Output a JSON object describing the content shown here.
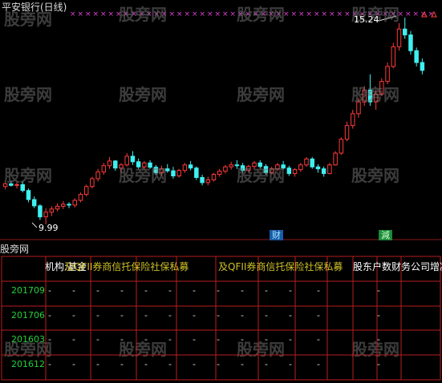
{
  "title": "平安银行(日线)",
  "watermark": "股旁网",
  "labels": {
    "high": "15.24",
    "low": "9.99"
  },
  "markers": {
    "cai": "财",
    "jian": "減"
  },
  "fund": {
    "title": "股旁网",
    "header_a": "机构:基金",
    "header_b": "及QFII券商信托保险社保私募",
    "header_c": "股东户数",
    "header_d": "财务公司",
    "header_e": "增减",
    "rows": [
      {
        "period": "201709",
        "cells": [
          "-",
          "-",
          "-",
          "-",
          "-",
          "-",
          "-",
          "-",
          "-",
          "-",
          "-",
          "-",
          "-"
        ]
      },
      {
        "period": "201706",
        "cells": [
          "-",
          "-",
          "-",
          "-",
          "-",
          "-",
          "-",
          "-",
          "-",
          "-",
          "-",
          "-",
          "-"
        ]
      },
      {
        "period": "201603",
        "cells": [
          "-",
          "-",
          "-",
          "-",
          "-",
          "-",
          "-",
          "-",
          "-",
          "-",
          "-",
          "-",
          "-"
        ]
      },
      {
        "period": "201612",
        "cells": [
          "-",
          "-",
          "-",
          "-",
          "-",
          "-",
          "-",
          "-",
          "-",
          "-",
          "-",
          "-",
          "-"
        ]
      }
    ]
  },
  "candles": [
    [
      10.95,
      11.05,
      10.88,
      11.02
    ],
    [
      11.02,
      11.1,
      10.95,
      10.98
    ],
    [
      10.98,
      11.06,
      10.9,
      11.0
    ],
    [
      11.0,
      11.08,
      10.8,
      10.85
    ],
    [
      10.85,
      10.9,
      10.55,
      10.62
    ],
    [
      10.62,
      10.7,
      10.4,
      10.46
    ],
    [
      10.46,
      10.5,
      10.1,
      10.18
    ],
    [
      10.18,
      10.4,
      9.99,
      10.3
    ],
    [
      10.3,
      10.45,
      10.2,
      10.38
    ],
    [
      10.38,
      10.52,
      10.32,
      10.45
    ],
    [
      10.45,
      10.58,
      10.38,
      10.5
    ],
    [
      10.5,
      10.55,
      10.4,
      10.48
    ],
    [
      10.48,
      10.65,
      10.42,
      10.6
    ],
    [
      10.6,
      10.8,
      10.55,
      10.75
    ],
    [
      10.75,
      11.0,
      10.7,
      10.95
    ],
    [
      10.95,
      11.2,
      10.9,
      11.15
    ],
    [
      11.15,
      11.4,
      11.08,
      11.32
    ],
    [
      11.32,
      11.55,
      11.25,
      11.48
    ],
    [
      11.48,
      11.7,
      11.4,
      11.6
    ],
    [
      11.6,
      11.62,
      11.35,
      11.42
    ],
    [
      11.42,
      11.55,
      11.3,
      11.5
    ],
    [
      11.5,
      11.8,
      11.46,
      11.72
    ],
    [
      11.72,
      11.85,
      11.5,
      11.58
    ],
    [
      11.58,
      11.66,
      11.4,
      11.45
    ],
    [
      11.45,
      11.6,
      11.38,
      11.55
    ],
    [
      11.55,
      11.62,
      11.4,
      11.44
    ],
    [
      11.44,
      11.5,
      11.25,
      11.3
    ],
    [
      11.3,
      11.48,
      11.22,
      11.4
    ],
    [
      11.4,
      11.52,
      11.3,
      11.35
    ],
    [
      11.35,
      11.45,
      11.15,
      11.22
    ],
    [
      11.22,
      11.4,
      11.18,
      11.36
    ],
    [
      11.36,
      11.55,
      11.3,
      11.5
    ],
    [
      11.5,
      11.6,
      11.36,
      11.42
    ],
    [
      11.42,
      11.46,
      11.12,
      11.18
    ],
    [
      11.18,
      11.25,
      10.98,
      11.05
    ],
    [
      11.05,
      11.2,
      10.98,
      11.12
    ],
    [
      11.12,
      11.3,
      11.08,
      11.26
    ],
    [
      11.26,
      11.4,
      11.2,
      11.34
    ],
    [
      11.34,
      11.5,
      11.28,
      11.45
    ],
    [
      11.45,
      11.58,
      11.38,
      11.5
    ],
    [
      11.5,
      11.62,
      11.4,
      11.48
    ],
    [
      11.48,
      11.55,
      11.3,
      11.36
    ],
    [
      11.36,
      11.5,
      11.3,
      11.46
    ],
    [
      11.46,
      11.6,
      11.4,
      11.55
    ],
    [
      11.55,
      11.62,
      11.42,
      11.46
    ],
    [
      11.46,
      11.52,
      11.25,
      11.3
    ],
    [
      11.3,
      11.45,
      11.26,
      11.4
    ],
    [
      11.4,
      11.55,
      11.35,
      11.5
    ],
    [
      11.5,
      11.6,
      11.38,
      11.42
    ],
    [
      11.42,
      11.48,
      11.22,
      11.28
    ],
    [
      11.28,
      11.42,
      11.2,
      11.38
    ],
    [
      11.38,
      11.55,
      11.32,
      11.5
    ],
    [
      11.5,
      11.7,
      11.45,
      11.65
    ],
    [
      11.65,
      11.7,
      11.4,
      11.45
    ],
    [
      11.45,
      11.52,
      11.3,
      11.4
    ],
    [
      11.4,
      11.46,
      11.2,
      11.28
    ],
    [
      11.28,
      11.55,
      11.26,
      11.5
    ],
    [
      11.5,
      11.85,
      11.48,
      11.8
    ],
    [
      11.8,
      12.2,
      11.75,
      12.15
    ],
    [
      12.15,
      12.6,
      12.1,
      12.5
    ],
    [
      12.5,
      12.9,
      12.42,
      12.8
    ],
    [
      12.8,
      13.2,
      12.7,
      13.1
    ],
    [
      13.1,
      13.5,
      13.0,
      13.4
    ],
    [
      13.4,
      13.8,
      13.0,
      13.1
    ],
    [
      13.1,
      13.4,
      12.9,
      13.3
    ],
    [
      13.3,
      13.7,
      13.25,
      13.62
    ],
    [
      13.62,
      14.1,
      13.55,
      14.0
    ],
    [
      14.0,
      14.6,
      13.95,
      14.5
    ],
    [
      14.5,
      15.1,
      14.4,
      14.95
    ],
    [
      14.95,
      15.24,
      14.7,
      14.8
    ],
    [
      14.8,
      14.9,
      14.3,
      14.4
    ],
    [
      14.4,
      14.48,
      14.0,
      14.1
    ],
    [
      14.1,
      14.2,
      13.8,
      13.9
    ]
  ],
  "colors": {
    "up": "#ff3b3b",
    "down": "#3ff0f0",
    "grid": "#b81e1e",
    "cross": "#e23fd6",
    "gridline": "#8a1c1c"
  }
}
